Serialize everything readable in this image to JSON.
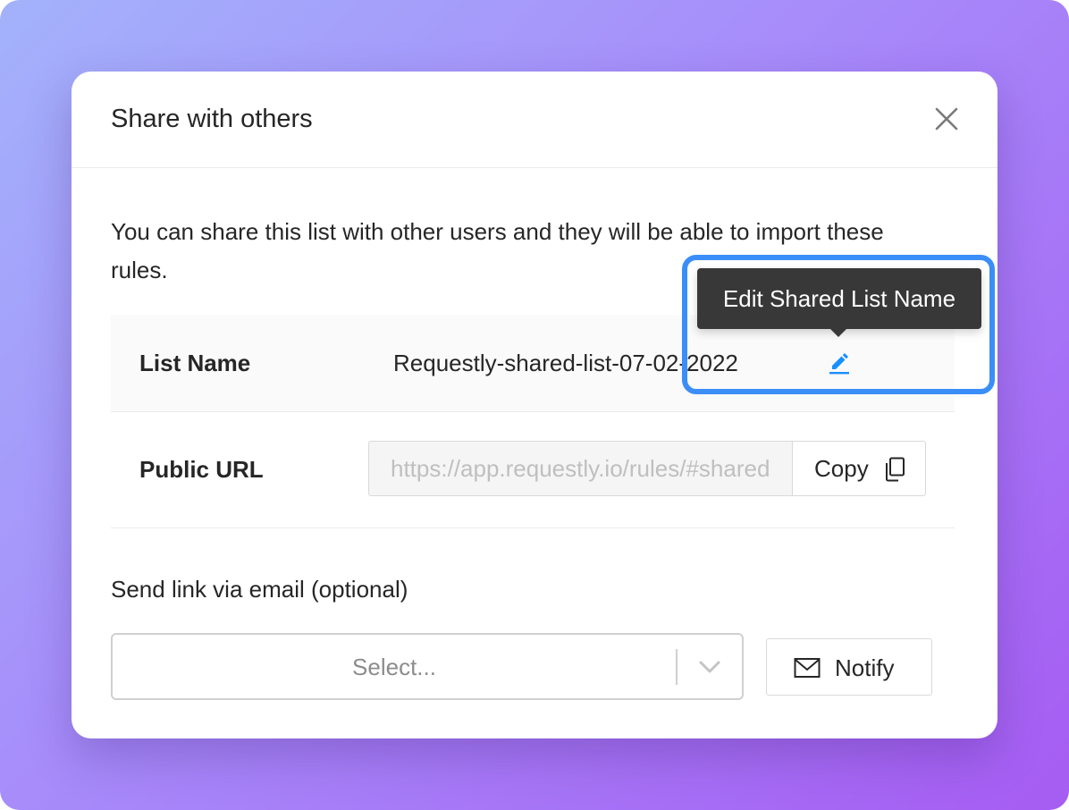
{
  "modal": {
    "title": "Share with others",
    "description": "You can share this list with other users and they will be able to import these rules."
  },
  "list_name": {
    "label": "List Name",
    "value": "Requestly-shared-list-07-02-2022",
    "edit_tooltip": "Edit Shared List Name"
  },
  "public_url": {
    "label": "Public URL",
    "value": "https://app.requestly.io/rules/#sharedList/",
    "copy_label": "Copy"
  },
  "email": {
    "label": "Send link via email (optional)",
    "select_placeholder": "Select...",
    "notify_label": "Notify"
  },
  "colors": {
    "accent_highlight": "#3b8ef8",
    "edit_icon": "#1890ff",
    "tooltip_bg": "#383838",
    "background_gradient_start": "#a3b2fb",
    "background_gradient_end": "#a65cf2"
  },
  "icons": {
    "close": "close-icon",
    "edit": "pencil-icon",
    "copy": "copy-icon",
    "chevron": "chevron-down-icon",
    "mail": "mail-icon"
  }
}
